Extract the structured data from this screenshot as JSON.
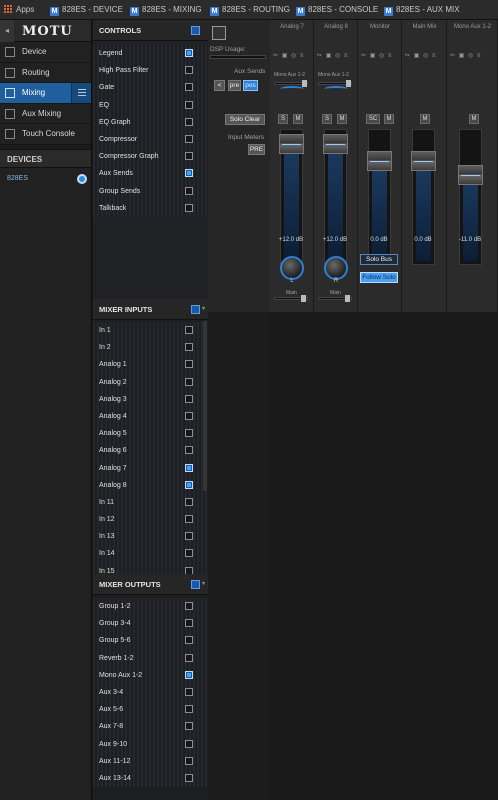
{
  "browser_tabs": [
    {
      "icon": "apps-icon",
      "label": "Apps"
    },
    {
      "icon": "M",
      "label": "828ES - DEVICE"
    },
    {
      "icon": "M",
      "label": "828ES - MIXING"
    },
    {
      "icon": "M",
      "label": "828ES - ROUTING"
    },
    {
      "icon": "M",
      "label": "828ES - CONSOLE"
    },
    {
      "icon": "M",
      "label": "828ES - AUX MIX"
    }
  ],
  "nav": {
    "logo": "MOTU",
    "back_icon": "◂",
    "items": [
      {
        "label": "Device",
        "icon": "device-icon"
      },
      {
        "label": "Routing",
        "icon": "routing-grid-icon"
      },
      {
        "label": "Mixing",
        "icon": "mixing-sliders-icon",
        "selected": true
      },
      {
        "label": "Aux Mixing",
        "icon": "aux-mixing-icon"
      },
      {
        "label": "Touch Console",
        "icon": "touch-console-icon"
      }
    ],
    "devices_heading": "DEVICES",
    "device_name": "828ES"
  },
  "controls": {
    "heading": "CONTROLS",
    "items": [
      {
        "label": "Legend",
        "checked": true
      },
      {
        "label": "High Pass Filter",
        "checked": false
      },
      {
        "label": "Gate",
        "checked": false
      },
      {
        "label": "EQ",
        "checked": false
      },
      {
        "label": "EQ Graph",
        "checked": false
      },
      {
        "label": "Compressor",
        "checked": false
      },
      {
        "label": "Compressor Graph",
        "checked": false
      },
      {
        "label": "Aux Sends",
        "checked": true
      },
      {
        "label": "Group Sends",
        "checked": false
      },
      {
        "label": "Talkback",
        "checked": false
      }
    ]
  },
  "mixer_inputs": {
    "heading": "MIXER INPUTS",
    "items": [
      {
        "label": "In 1",
        "checked": false
      },
      {
        "label": "In 2",
        "checked": false
      },
      {
        "label": "Analog 1",
        "checked": false
      },
      {
        "label": "Analog 2",
        "checked": false
      },
      {
        "label": "Analog 3",
        "checked": false
      },
      {
        "label": "Analog 4",
        "checked": false
      },
      {
        "label": "Analog 5",
        "checked": false
      },
      {
        "label": "Analog 6",
        "checked": false
      },
      {
        "label": "Analog 7",
        "checked": true
      },
      {
        "label": "Analog 8",
        "checked": true
      },
      {
        "label": "In 11",
        "checked": false
      },
      {
        "label": "In 12",
        "checked": false
      },
      {
        "label": "In 13",
        "checked": false
      },
      {
        "label": "In 14",
        "checked": false
      },
      {
        "label": "In 15",
        "checked": false
      }
    ]
  },
  "mixer_outputs": {
    "heading": "MIXER OUTPUTS",
    "items": [
      {
        "label": "Group 1-2",
        "checked": false
      },
      {
        "label": "Group 3-4",
        "checked": false
      },
      {
        "label": "Group 5-6",
        "checked": false
      },
      {
        "label": "Reverb 1-2",
        "checked": false
      },
      {
        "label": "Mono Aux 1-2",
        "checked": true
      },
      {
        "label": "Aux 3-4",
        "checked": false
      },
      {
        "label": "Aux 5-6",
        "checked": false
      },
      {
        "label": "Aux 7-8",
        "checked": false
      },
      {
        "label": "Aux 9-10",
        "checked": false
      },
      {
        "label": "Aux 11-12",
        "checked": false
      },
      {
        "label": "Aux 13-14",
        "checked": false
      }
    ]
  },
  "mixer": {
    "dsp_label": "DSP Usage:",
    "aux_sends_label": "Aux Sends",
    "solo_clear": "Solo Clear",
    "input_meters_label": "Input Meters",
    "pre_label": "PRE",
    "pre_post_buttons": [
      "<",
      "pre",
      "pos"
    ],
    "strips": [
      {
        "name": "Analog 7",
        "send_label": "Mono Aux 1-2",
        "solo": "S",
        "mute": "M",
        "level": "+12.0 dB",
        "fader": 1.0,
        "knob_label": "L",
        "bal_label": "Main"
      },
      {
        "name": "Analog 8",
        "send_label": "Mono Aux 1-2",
        "solo": "S",
        "mute": "M",
        "level": "+12.0 dB",
        "fader": 1.0,
        "knob_label": "R",
        "bal_label": "Main"
      },
      {
        "name": "Monitor",
        "solo": "SC",
        "mute": "M",
        "level": "0.0 dB",
        "fader": 0.85,
        "solo_bus": "Solo Bus",
        "follow_solo": "Follow Solo"
      },
      {
        "name": "Main Mix",
        "mute": "M",
        "level": "0.0 dB",
        "fader": 0.85
      },
      {
        "name": "Mono Aux 1-2",
        "mute": "M",
        "level": "-11.0 dB",
        "fader": 0.72
      }
    ],
    "accent_color": "#2f7fd8"
  }
}
